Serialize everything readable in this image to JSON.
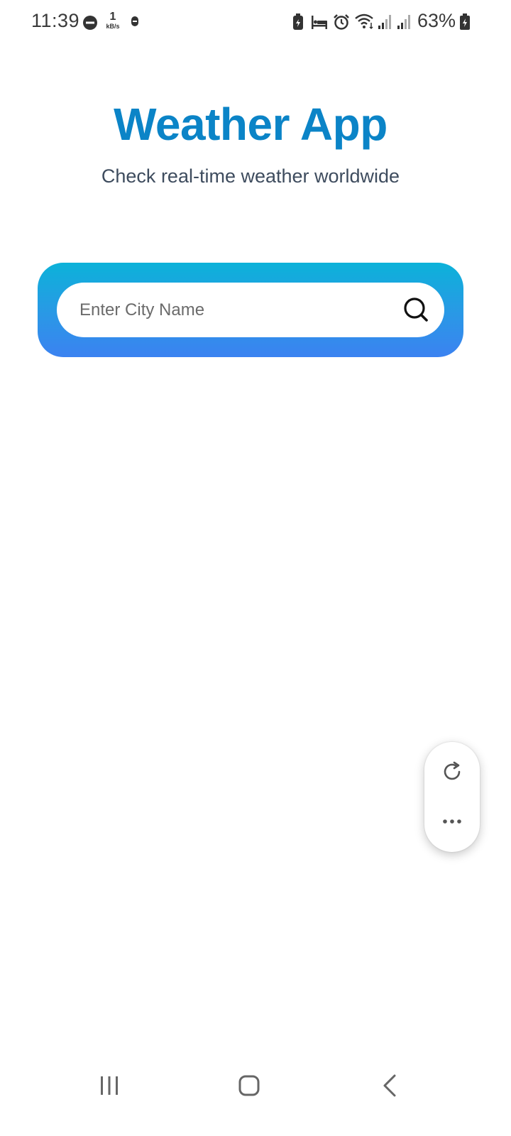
{
  "status_bar": {
    "time": "11:39",
    "net_speed_value": "1",
    "net_speed_unit": "kB/s",
    "battery_percent": "63%",
    "icons": [
      "dnd-icon",
      "bot-icon",
      "battery-saver-icon",
      "bed-icon",
      "alarm-icon",
      "wifi-icon",
      "signal-icon",
      "signal-icon",
      "battery-icon"
    ]
  },
  "header": {
    "title": "Weather App",
    "subtitle": "Check real-time weather worldwide"
  },
  "search": {
    "placeholder": "Enter City Name",
    "value": "",
    "icon": "search-icon"
  },
  "floating_actions": {
    "icons": [
      "refresh-icon",
      "more-icon"
    ]
  },
  "nav_bar": {
    "icons": [
      "recent-apps-icon",
      "home-icon",
      "back-icon"
    ]
  },
  "colors": {
    "title": "#0b84c7",
    "subtitle": "#3e4c5e",
    "gradient_top": "#0cb2d9",
    "gradient_bottom": "#3b82f1"
  }
}
